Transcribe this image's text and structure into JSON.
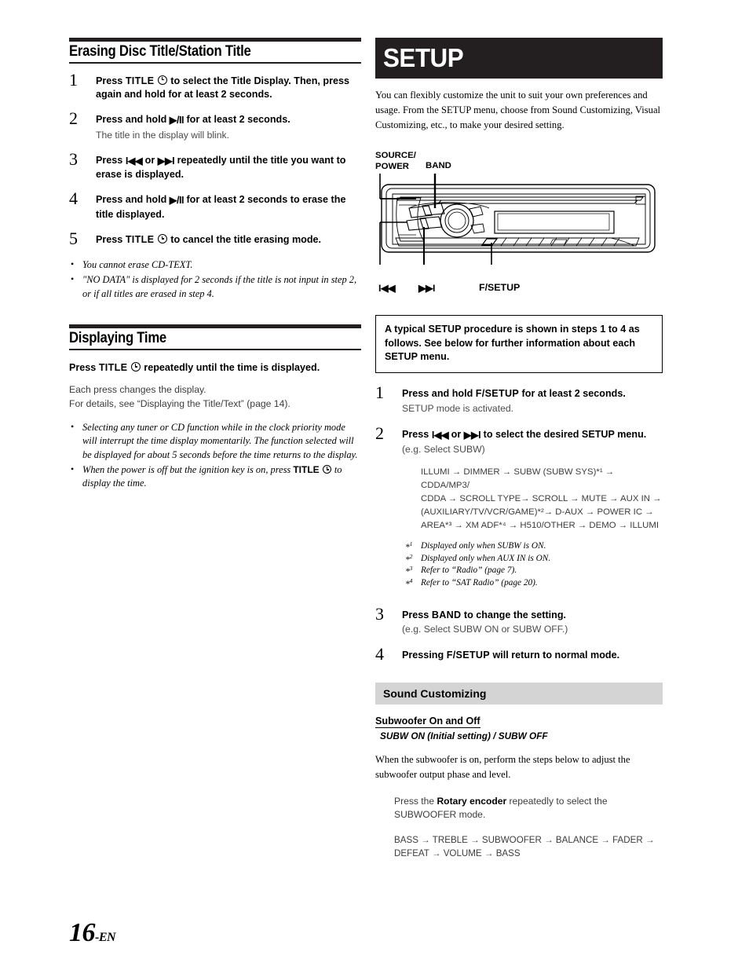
{
  "page": {
    "number": "16",
    "suffix": "-EN"
  },
  "left": {
    "section1": {
      "title": "Erasing Disc Title/Station Title",
      "steps": [
        {
          "num": "1",
          "body_pre": "Press ",
          "kb1": "TITLE",
          "icon": "clock-icon",
          "body_post": " to select the Title Display. Then, press again and hold for at least 2 seconds.",
          "sub": ""
        },
        {
          "num": "2",
          "body_pre": "Press and hold ",
          "kb1": "▶/II",
          "body_post": " for at least 2 seconds.",
          "sub": "The title in the display will blink."
        },
        {
          "num": "3",
          "body_pre": "Press ",
          "kb1": "I◀◀",
          "mid": " or ",
          "kb2": "▶▶I",
          "body_post": " repeatedly until the title you want to erase is displayed.",
          "sub": ""
        },
        {
          "num": "4",
          "body_pre": "Press and hold ",
          "kb1": "▶/II",
          "body_post": " for at least 2 seconds to erase the title displayed.",
          "sub": ""
        },
        {
          "num": "5",
          "body_pre": "Press ",
          "kb1": "TITLE",
          "icon": "clock-icon",
          "body_post": " to cancel the title erasing mode.",
          "sub": ""
        }
      ],
      "notes": [
        "You cannot erase CD-TEXT.",
        "\"NO DATA\" is displayed for 2 seconds if the title is not input in step 2, or if all titles are erased in step 4."
      ]
    },
    "section2": {
      "title": "Displaying Time",
      "lead_pre": "Press ",
      "lead_kb": "TITLE",
      "lead_post": " repeatedly until the time is displayed.",
      "plain_line1": "Each press changes the display.",
      "plain_line2": "For details, see “Displaying the Title/Text” (page 14).",
      "notes": [
        "Selecting any tuner or CD function while in the clock priority mode will interrupt the time display momentarily. The function selected will be displayed for about 5 seconds before the time returns to the display.",
        "When the power is off but the ignition key is on, press TITLE ⓘ to display the time."
      ],
      "note2_pre": "When the power is off but the ignition key is on, press ",
      "note2_kb": "TITLE",
      "note2_post": " to display the time."
    }
  },
  "right": {
    "chapter_title": "SETUP",
    "intro": "You can flexibly customize the unit to suit your own preferences and usage. From the SETUP menu, choose from Sound Customizing, Visual Customizing, etc., to make your desired setting.",
    "diagram": {
      "label_source": "SOURCE/",
      "label_power": "POWER",
      "label_band": "BAND",
      "label_prev": "I◀◀",
      "label_next": "▶▶I",
      "label_fsetup": "F/SETUP"
    },
    "boxnote": "A typical SETUP procedure is shown in steps 1 to 4 as follows. See below for further information about each SETUP menu.",
    "steps": [
      {
        "num": "1",
        "body_pre": "Press and hold ",
        "kb1": "F/SETUP",
        "body_post": " for at least 2 seconds.",
        "sub": "SETUP mode is activated."
      },
      {
        "num": "2",
        "body_pre": "Press ",
        "kb1": "I◀◀",
        "mid": " or ",
        "kb2": "▶▶I",
        "body_post": " to select the desired SETUP menu.",
        "sub": "(e.g. Select SUBW)"
      },
      {
        "num": "3",
        "body_pre": "Press ",
        "kb1": "BAND",
        "body_post": " to change the setting.",
        "sub": "(e.g. Select SUBW ON or SUBW OFF.)"
      },
      {
        "num": "4",
        "body_pre": "Pressing ",
        "kb1": "F/SETUP",
        "body_post": " will return to normal mode.",
        "sub": ""
      }
    ],
    "menu_chain_lines": [
      "ILLUMI → DIMMER → SUBW (SUBW SYS)*¹ → CDDA/MP3/",
      "CDDA → SCROLL TYPE→ SCROLL → MUTE → AUX IN →",
      "(AUXILIARY/TV/VCR/GAME)*²→ D-AUX → POWER IC →",
      "AREA*³ → XM ADF*⁴ → H510/OTHER → DEMO → ILLUMI"
    ],
    "footnotes": [
      {
        "mark": "*1",
        "text": "Displayed only when SUBW is ON."
      },
      {
        "mark": "*2",
        "text": "Displayed only when AUX IN is ON."
      },
      {
        "mark": "*3",
        "text": "Refer to “Radio” (page 7)."
      },
      {
        "mark": "*4",
        "text": "Refer to “SAT Radio” (page 20)."
      }
    ],
    "sound_customizing": {
      "bar_title": "Sound Customizing",
      "sub_head": "Subwoofer On and Off",
      "setting": "SUBW ON (Initial setting) / SUBW OFF",
      "body": "When the subwoofer is on, perform the steps below to adjust the subwoofer output phase and level.",
      "instruction_pre": "Press the ",
      "instruction_kb": "Rotary encoder",
      "instruction_post": " repeatedly to select the SUBWOOFER mode.",
      "chain_line1": "BASS → TREBLE → SUBWOOFER → BALANCE → FADER →",
      "chain_line2": "DEFEAT → VOLUME → BASS"
    }
  }
}
